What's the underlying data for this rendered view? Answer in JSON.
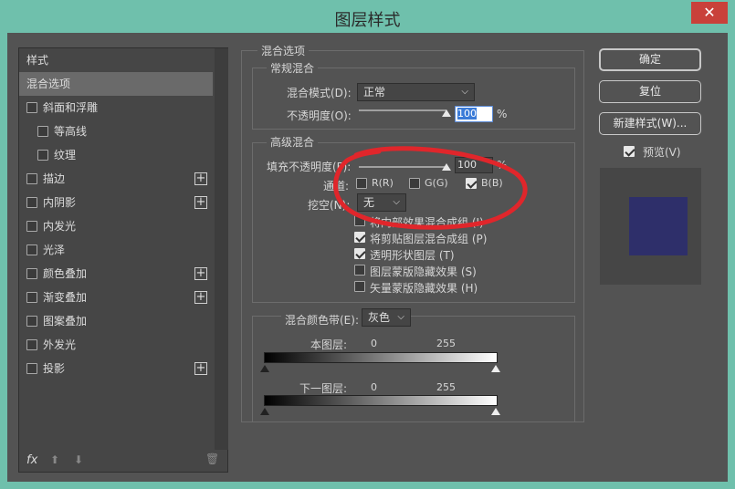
{
  "window": {
    "title": "图层样式",
    "close_glyph": "✕"
  },
  "left_panel": {
    "items": [
      {
        "label": "样式",
        "checkbox": false,
        "checked": false,
        "plus": false,
        "indent": 0,
        "selected": false
      },
      {
        "label": "混合选项",
        "checkbox": false,
        "checked": false,
        "plus": false,
        "indent": 0,
        "selected": true
      },
      {
        "label": "斜面和浮雕",
        "checkbox": true,
        "checked": false,
        "plus": false,
        "indent": 0,
        "selected": false
      },
      {
        "label": "等高线",
        "checkbox": true,
        "checked": false,
        "plus": false,
        "indent": 1,
        "selected": false
      },
      {
        "label": "纹理",
        "checkbox": true,
        "checked": false,
        "plus": false,
        "indent": 1,
        "selected": false
      },
      {
        "label": "描边",
        "checkbox": true,
        "checked": false,
        "plus": true,
        "indent": 0,
        "selected": false
      },
      {
        "label": "内阴影",
        "checkbox": true,
        "checked": false,
        "plus": true,
        "indent": 0,
        "selected": false
      },
      {
        "label": "内发光",
        "checkbox": true,
        "checked": false,
        "plus": false,
        "indent": 0,
        "selected": false
      },
      {
        "label": "光泽",
        "checkbox": true,
        "checked": false,
        "plus": false,
        "indent": 0,
        "selected": false
      },
      {
        "label": "颜色叠加",
        "checkbox": true,
        "checked": false,
        "plus": true,
        "indent": 0,
        "selected": false
      },
      {
        "label": "渐变叠加",
        "checkbox": true,
        "checked": false,
        "plus": true,
        "indent": 0,
        "selected": false
      },
      {
        "label": "图案叠加",
        "checkbox": true,
        "checked": false,
        "plus": false,
        "indent": 0,
        "selected": false
      },
      {
        "label": "外发光",
        "checkbox": true,
        "checked": false,
        "plus": false,
        "indent": 0,
        "selected": false
      },
      {
        "label": "投影",
        "checkbox": true,
        "checked": false,
        "plus": true,
        "indent": 0,
        "selected": false
      }
    ],
    "footer": {
      "fx": "fx",
      "up_glyph": "⬆",
      "down_glyph": "⬇",
      "trash_glyph": "🗑"
    }
  },
  "blend": {
    "section_title": "混合选项",
    "general": {
      "title": "常规混合",
      "mode_label": "混合模式(D):",
      "mode_value": "正常",
      "opacity_label": "不透明度(O):",
      "opacity_value": "100",
      "opacity_unit": "%",
      "opacity_level": 1.0
    },
    "advanced": {
      "title": "高级混合",
      "fill_label": "填充不透明度(F):",
      "fill_value": "100",
      "fill_unit": "%",
      "fill_level": 1.0,
      "channels_label": "通道:",
      "channels": [
        {
          "label": "R(R)",
          "checked": false
        },
        {
          "label": "G(G)",
          "checked": false
        },
        {
          "label": "B(B)",
          "checked": true
        }
      ],
      "knockout_label": "挖空(N):",
      "knockout_value": "无",
      "options": [
        {
          "label": "将内部效果混合成组 (I)",
          "checked": false
        },
        {
          "label": "将剪贴图层混合成组 (P)",
          "checked": true
        },
        {
          "label": "透明形状图层 (T)",
          "checked": true
        },
        {
          "label": "图层蒙版隐藏效果 (S)",
          "checked": false
        },
        {
          "label": "矢量蒙版隐藏效果 (H)",
          "checked": false
        }
      ]
    },
    "blend_if": {
      "label": "混合颜色带(E):",
      "value": "灰色",
      "this_layer": {
        "label": "本图层:",
        "min": "0",
        "max": "255"
      },
      "under_layer": {
        "label": "下一图层:",
        "min": "0",
        "max": "255"
      }
    }
  },
  "buttons": {
    "ok": "确定",
    "reset": "复位",
    "new_style": "新建样式(W)...",
    "preview_label": "预览(V)",
    "preview_checked": true
  },
  "colors": {
    "preview_swatch": "#2e2f6a",
    "annotation": "#e0262b"
  }
}
